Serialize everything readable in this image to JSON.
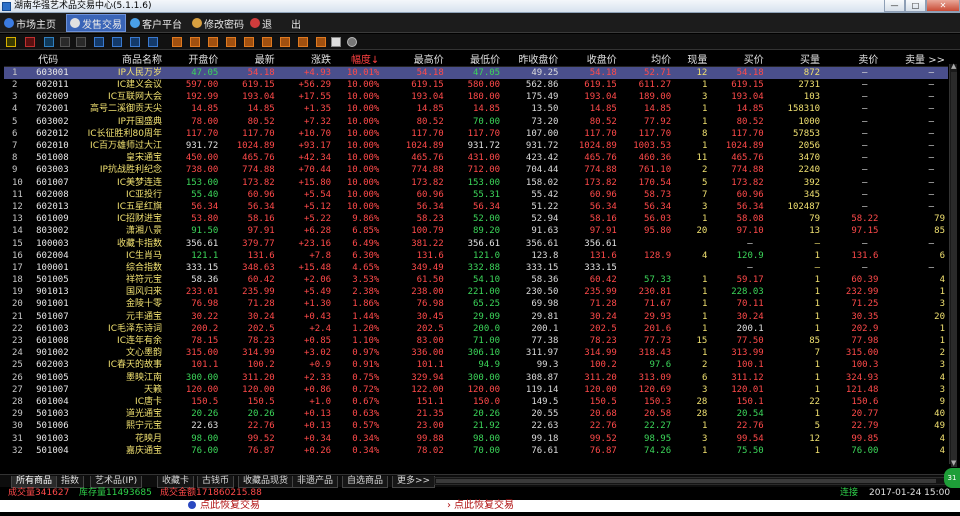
{
  "window": {
    "title": "湖南华强艺术品交易中心(5.1.1.6)",
    "min": "—",
    "max": "□",
    "close": "✕"
  },
  "menu": [
    {
      "label": "市场主页",
      "icon": "globe-icon"
    },
    {
      "label": "发售交易",
      "icon": "trade-icon"
    },
    {
      "label": "客户平台",
      "icon": "client-icon"
    },
    {
      "label": "修改密码",
      "icon": "key-icon"
    },
    {
      "label": "退",
      "icon": "exit-icon"
    },
    {
      "label": "出",
      "icon": ""
    }
  ],
  "toolbar_icons": [
    "bar-chart-icon",
    "trend-icon",
    "candle-icon",
    "table-icon",
    "grid-icon",
    "f10-icon",
    "f11-icon",
    "f12-icon",
    "f1-icon",
    "f2-icon",
    "f3-icon",
    "f4-icon",
    "f5-icon",
    "f6-icon",
    "f7-icon",
    "f8-icon",
    "f9-icon",
    "note-icon",
    "settings-icon"
  ],
  "table": {
    "headers": [
      "",
      "代码",
      "商品名称",
      "开盘价",
      "最新",
      "涨跌",
      "幅度↓",
      "最高价",
      "最低价",
      "昨收盘价",
      "收盘价",
      "均价",
      "现量",
      "买价",
      "买量",
      "卖价",
      "卖量 >>"
    ],
    "rows": [
      [
        "1",
        "603001",
        "IP人民万岁",
        "47.05",
        "54.18",
        "+4.93",
        "10.01%",
        "54.18",
        "47.05",
        "49.25",
        "54.18",
        "52.71",
        "12",
        "54.18",
        "872",
        "—",
        "—"
      ],
      [
        "2",
        "602011",
        "IC建义会议",
        "597.00",
        "619.15",
        "+56.29",
        "10.00%",
        "619.15",
        "580.00",
        "562.86",
        "619.15",
        "611.27",
        "1",
        "619.15",
        "2731",
        "—",
        "—"
      ],
      [
        "3",
        "602009",
        "IC互联网大会",
        "192.99",
        "193.04",
        "+17.55",
        "10.00%",
        "193.04",
        "180.00",
        "175.49",
        "193.04",
        "189.00",
        "3",
        "193.04",
        "103",
        "—",
        "—"
      ],
      [
        "4",
        "702001",
        "高号二溪御贡天尖",
        "14.85",
        "14.85",
        "+1.35",
        "10.00%",
        "14.85",
        "14.85",
        "13.50",
        "14.85",
        "14.85",
        "1",
        "14.85",
        "158310",
        "—",
        "—"
      ],
      [
        "5",
        "603002",
        "IP开国盛典",
        "78.00",
        "80.52",
        "+7.32",
        "10.00%",
        "80.52",
        "70.00",
        "73.20",
        "80.52",
        "77.92",
        "1",
        "80.52",
        "1000",
        "—",
        "—"
      ],
      [
        "6",
        "602012",
        "IC长征胜利80周年",
        "117.70",
        "117.70",
        "+10.70",
        "10.00%",
        "117.70",
        "117.70",
        "107.00",
        "117.70",
        "117.70",
        "8",
        "117.70",
        "57853",
        "—",
        "—"
      ],
      [
        "7",
        "602010",
        "IC百万雄师过大江",
        "931.72",
        "1024.89",
        "+93.17",
        "10.00%",
        "1024.89",
        "931.72",
        "931.72",
        "1024.89",
        "1003.53",
        "1",
        "1024.89",
        "2056",
        "—",
        "—"
      ],
      [
        "8",
        "501008",
        "皇宋通宝",
        "450.00",
        "465.76",
        "+42.34",
        "10.00%",
        "465.76",
        "431.00",
        "423.42",
        "465.76",
        "460.36",
        "11",
        "465.76",
        "3470",
        "—",
        "—"
      ],
      [
        "9",
        "603003",
        "IP抗战胜利纪念",
        "738.00",
        "774.88",
        "+70.44",
        "10.00%",
        "774.88",
        "712.00",
        "704.44",
        "774.88",
        "761.10",
        "2",
        "774.88",
        "2240",
        "—",
        "—"
      ],
      [
        "10",
        "601007",
        "IC美梦连连",
        "153.00",
        "173.82",
        "+15.80",
        "10.00%",
        "173.82",
        "153.00",
        "158.02",
        "173.82",
        "170.54",
        "5",
        "173.82",
        "392",
        "—",
        "—"
      ],
      [
        "11",
        "602008",
        "IC亚投行",
        "55.40",
        "60.96",
        "+5.54",
        "10.00%",
        "60.96",
        "55.31",
        "55.42",
        "60.96",
        "58.73",
        "7",
        "60.96",
        "345",
        "—",
        "—"
      ],
      [
        "12",
        "602013",
        "IC五星红旗",
        "56.34",
        "56.34",
        "+5.12",
        "10.00%",
        "56.34",
        "56.34",
        "51.22",
        "56.34",
        "56.34",
        "3",
        "56.34",
        "102487",
        "—",
        "—"
      ],
      [
        "13",
        "601009",
        "IC招财进宝",
        "53.80",
        "58.16",
        "+5.22",
        "9.86%",
        "58.23",
        "52.00",
        "52.94",
        "58.16",
        "56.03",
        "1",
        "58.08",
        "79",
        "58.22",
        "79"
      ],
      [
        "14",
        "803002",
        "潇湘八景",
        "91.50",
        "97.91",
        "+6.28",
        "6.85%",
        "100.79",
        "89.20",
        "91.63",
        "97.91",
        "95.80",
        "20",
        "97.10",
        "13",
        "97.15",
        "85"
      ],
      [
        "15",
        "100003",
        "收藏卡指数",
        "356.61",
        "379.77",
        "+23.16",
        "6.49%",
        "381.22",
        "356.61",
        "356.61",
        "356.61",
        "",
        "",
        "—",
        "—",
        "—",
        "—"
      ],
      [
        "16",
        "602004",
        "IC生肖马",
        "121.1",
        "131.6",
        "+7.8",
        "6.30%",
        "131.6",
        "121.0",
        "123.8",
        "131.6",
        "128.9",
        "4",
        "120.9",
        "1",
        "131.6",
        "6"
      ],
      [
        "17",
        "100001",
        "综合指数",
        "333.15",
        "348.63",
        "+15.48",
        "4.65%",
        "349.49",
        "332.88",
        "333.15",
        "333.15",
        "",
        "",
        "—",
        "—",
        "—",
        "—"
      ],
      [
        "18",
        "501005",
        "祥符元宝",
        "58.36",
        "60.42",
        "+2.06",
        "3.53%",
        "61.50",
        "54.10",
        "58.36",
        "60.42",
        "57.33",
        "1",
        "59.17",
        "1",
        "60.39",
        "4"
      ],
      [
        "19",
        "901013",
        "国风归来",
        "233.01",
        "235.99",
        "+5.49",
        "2.38%",
        "238.00",
        "221.00",
        "230.50",
        "235.99",
        "230.81",
        "1",
        "228.03",
        "1",
        "232.99",
        "1"
      ],
      [
        "20",
        "901001",
        "金陵十零",
        "76.98",
        "71.28",
        "+1.30",
        "1.86%",
        "76.98",
        "65.25",
        "69.98",
        "71.28",
        "71.67",
        "1",
        "70.11",
        "1",
        "71.25",
        "3"
      ],
      [
        "21",
        "501007",
        "元丰通宝",
        "30.22",
        "30.24",
        "+0.43",
        "1.44%",
        "30.45",
        "29.09",
        "29.81",
        "30.24",
        "29.93",
        "1",
        "30.24",
        "1",
        "30.35",
        "20"
      ],
      [
        "22",
        "601003",
        "IC毛泽东诗词",
        "200.2",
        "202.5",
        "+2.4",
        "1.20%",
        "202.5",
        "200.0",
        "200.1",
        "202.5",
        "201.6",
        "1",
        "200.1",
        "1",
        "202.9",
        "1"
      ],
      [
        "23",
        "601008",
        "IC连年有余",
        "78.15",
        "78.23",
        "+0.85",
        "1.10%",
        "83.00",
        "71.00",
        "77.38",
        "78.23",
        "77.73",
        "15",
        "77.50",
        "85",
        "77.98",
        "1"
      ],
      [
        "24",
        "901002",
        "文心墨韵",
        "315.00",
        "314.99",
        "+3.02",
        "0.97%",
        "336.00",
        "306.10",
        "311.97",
        "314.99",
        "318.43",
        "1",
        "313.99",
        "7",
        "315.00",
        "2"
      ],
      [
        "25",
        "602003",
        "IC春天的故事",
        "101.1",
        "100.2",
        "+0.9",
        "0.91%",
        "101.1",
        "94.9",
        "99.3",
        "100.2",
        "97.6",
        "2",
        "100.1",
        "1",
        "100.3",
        "3"
      ],
      [
        "26",
        "901005",
        "墨映江南",
        "300.00",
        "311.20",
        "+2.33",
        "0.75%",
        "329.94",
        "300.00",
        "308.87",
        "311.20",
        "313.09",
        "6",
        "311.12",
        "1",
        "324.93",
        "4"
      ],
      [
        "27",
        "901007",
        "天籁",
        "120.00",
        "120.00",
        "+0.86",
        "0.72%",
        "122.00",
        "120.00",
        "119.14",
        "120.00",
        "120.69",
        "3",
        "120.01",
        "1",
        "121.48",
        "3"
      ],
      [
        "28",
        "601004",
        "IC唐卡",
        "150.5",
        "150.5",
        "+1.0",
        "0.67%",
        "151.1",
        "150.0",
        "149.5",
        "150.5",
        "150.3",
        "28",
        "150.1",
        "22",
        "150.6",
        "9"
      ],
      [
        "29",
        "501003",
        "道光通宝",
        "20.26",
        "20.26",
        "+0.13",
        "0.63%",
        "21.35",
        "20.26",
        "20.55",
        "20.68",
        "20.58",
        "28",
        "20.54",
        "1",
        "20.77",
        "40"
      ],
      [
        "30",
        "501006",
        "熙宁元宝",
        "22.63",
        "22.76",
        "+0.13",
        "0.57%",
        "23.00",
        "21.92",
        "22.63",
        "22.76",
        "22.27",
        "1",
        "22.76",
        "5",
        "22.79",
        "49"
      ],
      [
        "31",
        "901003",
        "花映月",
        "98.00",
        "99.52",
        "+0.34",
        "0.34%",
        "99.88",
        "98.00",
        "99.18",
        "99.52",
        "98.95",
        "3",
        "99.54",
        "12",
        "99.85",
        "4"
      ],
      [
        "32",
        "501004",
        "嘉庆通宝",
        "76.00",
        "76.87",
        "+0.26",
        "0.34%",
        "78.02",
        "70.00",
        "76.61",
        "76.87",
        "74.26",
        "1",
        "75.50",
        "1",
        "76.00",
        "4"
      ]
    ]
  },
  "tabs": [
    "所有商品",
    "指数",
    "艺术品(IP)",
    "收藏卡",
    "古钱币",
    "收藏品现货",
    "非遗产品",
    "自选商品",
    "更多>>"
  ],
  "status": {
    "volume_label": "成交量341627",
    "stock_label": "库存量11493685",
    "amount_label": "成交金额171860215.88",
    "conn": "连接",
    "datetime": "2017-01-24 15:00"
  },
  "notices": [
    "点此恢复交易",
    "点此恢复交易"
  ],
  "badge": "31"
}
